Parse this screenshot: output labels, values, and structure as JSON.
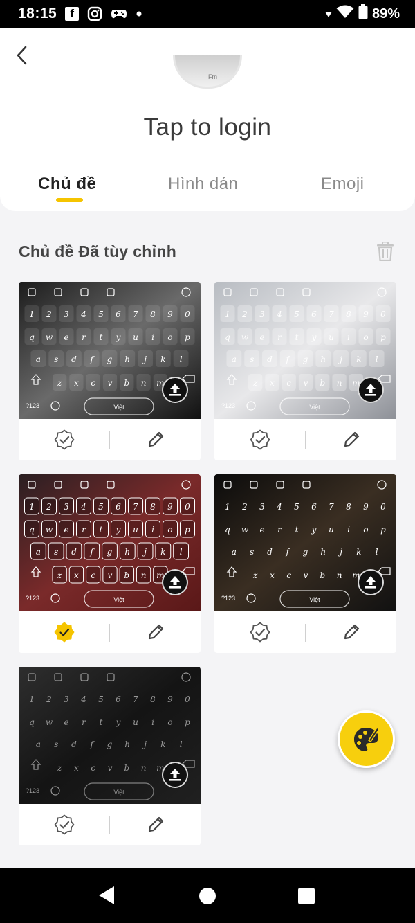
{
  "status_bar": {
    "time": "18:15",
    "battery": "89%",
    "icons": [
      "facebook-icon",
      "instagram-icon",
      "gamepad-icon",
      "dot-icon",
      "wifi-icon",
      "battery-icon"
    ]
  },
  "header": {
    "login_text": "Tap to login",
    "avatar_text": "Fm"
  },
  "tabs": [
    {
      "label": "Chủ đề",
      "active": true
    },
    {
      "label": "Hình dán",
      "active": false
    },
    {
      "label": "Emoji",
      "active": false
    }
  ],
  "section": {
    "title": "Chủ đề Đã tùy chỉnh"
  },
  "keyboard": {
    "rows": [
      [
        "1",
        "2",
        "3",
        "4",
        "5",
        "6",
        "7",
        "8",
        "9",
        "0"
      ],
      [
        "q",
        "w",
        "e",
        "r",
        "t",
        "y",
        "u",
        "i",
        "o",
        "p"
      ],
      [
        "a",
        "s",
        "d",
        "f",
        "g",
        "h",
        "j",
        "k",
        "l"
      ],
      [
        "z",
        "x",
        "c",
        "v",
        "b",
        "n",
        "m"
      ]
    ],
    "mode_key": "?123",
    "space_label": "Việt"
  },
  "themes": [
    {
      "selected": false,
      "style": "dark-photo"
    },
    {
      "selected": false,
      "style": "light-photo"
    },
    {
      "selected": true,
      "style": "red-photo"
    },
    {
      "selected": false,
      "style": "night-photo"
    },
    {
      "selected": false,
      "style": "plain-dark"
    }
  ],
  "colors": {
    "accent": "#f5c400",
    "fab": "#f7cf0d",
    "background": "#f4f4f6"
  }
}
